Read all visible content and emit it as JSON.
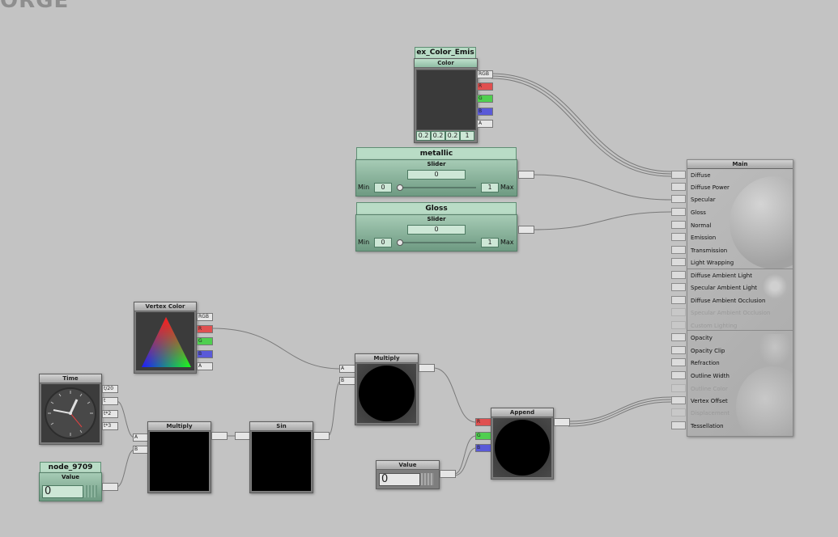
{
  "app": {
    "logo_text": "ORGE"
  },
  "color_node": {
    "title": "ex_Color_Emis",
    "header": "Color",
    "swatch_color": "#3a3a3a",
    "values": [
      "0.2",
      "0.2",
      "0.2",
      "1"
    ],
    "outputs": [
      "RGB",
      "R",
      "G",
      "B",
      "A"
    ]
  },
  "metallic_node": {
    "title": "metallic",
    "header": "Slider",
    "value": "0",
    "min_label": "Min",
    "min": "0",
    "max": "1",
    "max_label": "Max",
    "slider_level": 0
  },
  "gloss_node": {
    "title": "Gloss",
    "header": "Slider",
    "value": "0",
    "min_label": "Min",
    "min": "0",
    "max": "1",
    "max_label": "Max",
    "slider_level": 0
  },
  "vertex_color_node": {
    "header": "Vertex Color",
    "outputs": [
      "RGB",
      "R",
      "G",
      "B",
      "A"
    ]
  },
  "time_node": {
    "header": "Time",
    "outputs": [
      "t/20",
      "t",
      "t*2",
      "t*3"
    ]
  },
  "value_node_9709": {
    "title": "node_9709",
    "header": "Value",
    "value": "0"
  },
  "multiply_node_1": {
    "header": "Multiply",
    "inputs": [
      "A",
      "B"
    ]
  },
  "sin_node": {
    "header": "Sin"
  },
  "multiply_node_2": {
    "header": "Multiply",
    "inputs": [
      "A",
      "B"
    ]
  },
  "value_node_2": {
    "header": "Value",
    "value": "0"
  },
  "append_node": {
    "header": "Append",
    "inputs": [
      "R",
      "G",
      "B"
    ]
  },
  "main_node": {
    "header": "Main",
    "inputs": [
      {
        "label": "Diffuse",
        "enabled": true
      },
      {
        "label": "Diffuse Power",
        "enabled": true
      },
      {
        "label": "Specular",
        "enabled": true
      },
      {
        "label": "Gloss",
        "enabled": true
      },
      {
        "label": "Normal",
        "enabled": true
      },
      {
        "label": "Emission",
        "enabled": true
      },
      {
        "label": "Transmission",
        "enabled": true
      },
      {
        "label": "Light Wrapping",
        "enabled": true
      },
      {
        "label": "Diffuse Ambient Light",
        "enabled": true
      },
      {
        "label": "Specular Ambient Light",
        "enabled": true
      },
      {
        "label": "Diffuse Ambient Occlusion",
        "enabled": true
      },
      {
        "label": "Specular Ambient Occlusion",
        "enabled": false
      },
      {
        "label": "Custom Lighting",
        "enabled": false
      },
      {
        "label": "Opacity",
        "enabled": true
      },
      {
        "label": "Opacity Clip",
        "enabled": true
      },
      {
        "label": "Refraction",
        "enabled": true
      },
      {
        "label": "Outline Width",
        "enabled": true
      },
      {
        "label": "Outline Color",
        "enabled": false
      },
      {
        "label": "Vertex Offset",
        "enabled": true
      },
      {
        "label": "Displacement",
        "enabled": false
      },
      {
        "label": "Tessellation",
        "enabled": true
      }
    ]
  }
}
